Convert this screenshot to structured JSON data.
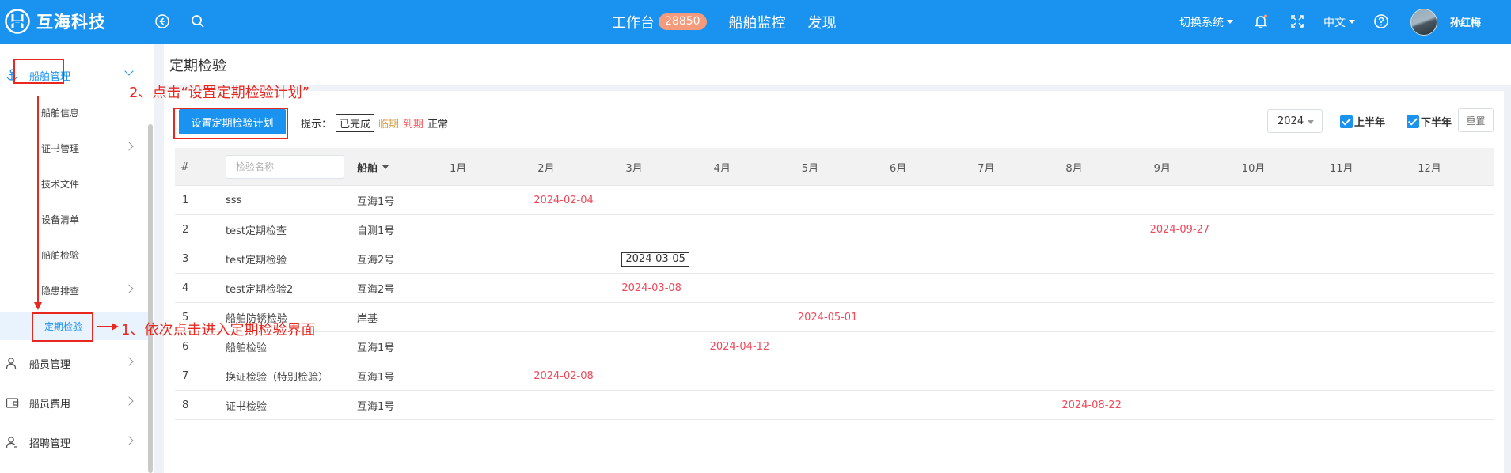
{
  "topbar": {
    "brand": "互海科技",
    "nav": [
      {
        "label": "工作台",
        "badge": "28850"
      },
      {
        "label": "船舶监控"
      },
      {
        "label": "发现"
      }
    ],
    "switch_system": "切换系统",
    "language": "中文",
    "user_name": "孙红梅"
  },
  "sidebar": {
    "items": [
      {
        "label": "船舶管理",
        "icon": "anchor-icon"
      },
      {
        "label": "船舶信息"
      },
      {
        "label": "证书管理"
      },
      {
        "label": "技术文件"
      },
      {
        "label": "设备清单"
      },
      {
        "label": "船舶检验"
      },
      {
        "label": "隐患排查"
      },
      {
        "label": "定期检验"
      },
      {
        "label": "船员管理",
        "icon": "user-icon"
      },
      {
        "label": "船员费用",
        "icon": "wallet-icon"
      },
      {
        "label": "招聘管理",
        "icon": "recruit-icon"
      }
    ]
  },
  "page": {
    "title": "定期检验",
    "setup_button": "设置定期检验计划",
    "legend_label": "提示：",
    "legend": {
      "done": "已完成",
      "near": "临期",
      "due": "到期",
      "normal": "正常"
    },
    "year": "2024",
    "first_half": "上半年",
    "second_half": "下半年",
    "reset": "重置"
  },
  "table": {
    "col_index": "#",
    "name_placeholder": "检验名称",
    "col_ship": "船舶",
    "months": [
      "1月",
      "2月",
      "3月",
      "4月",
      "5月",
      "6月",
      "7月",
      "8月",
      "9月",
      "10月",
      "11月",
      "12月"
    ],
    "rows": [
      {
        "no": "1",
        "name": "sss",
        "ship": "互海1号",
        "date": "2024-02-04",
        "month": 2,
        "status": "due"
      },
      {
        "no": "2",
        "name": "test定期检查",
        "ship": "自测1号",
        "date": "2024-09-27",
        "month": 9,
        "status": "due"
      },
      {
        "no": "3",
        "name": "test定期检验",
        "ship": "互海2号",
        "date": "2024-03-05",
        "month": 3,
        "status": "done"
      },
      {
        "no": "4",
        "name": "test定期检验2",
        "ship": "互海2号",
        "date": "2024-03-08",
        "month": 3,
        "status": "due"
      },
      {
        "no": "5",
        "name": "船舶防锈检验",
        "ship": "岸基",
        "date": "2024-05-01",
        "month": 5,
        "status": "due"
      },
      {
        "no": "6",
        "name": "船舶检验",
        "ship": "互海1号",
        "date": "2024-04-12",
        "month": 4,
        "status": "due"
      },
      {
        "no": "7",
        "name": "换证检验（特别检验）",
        "ship": "互海1号",
        "date": "2024-02-08",
        "month": 2,
        "status": "due"
      },
      {
        "no": "8",
        "name": "证书检验",
        "ship": "互海1号",
        "date": "2024-08-22",
        "month": 8,
        "status": "due"
      }
    ]
  },
  "annotations": {
    "step1": "1、依次点击进入定期检验界面",
    "step2": "2、点击“设置定期检验计划”",
    "color": "#e8271f"
  },
  "colors": {
    "primary": "#1a93f0",
    "due": "#f0495a",
    "near": "#d8a24a"
  }
}
